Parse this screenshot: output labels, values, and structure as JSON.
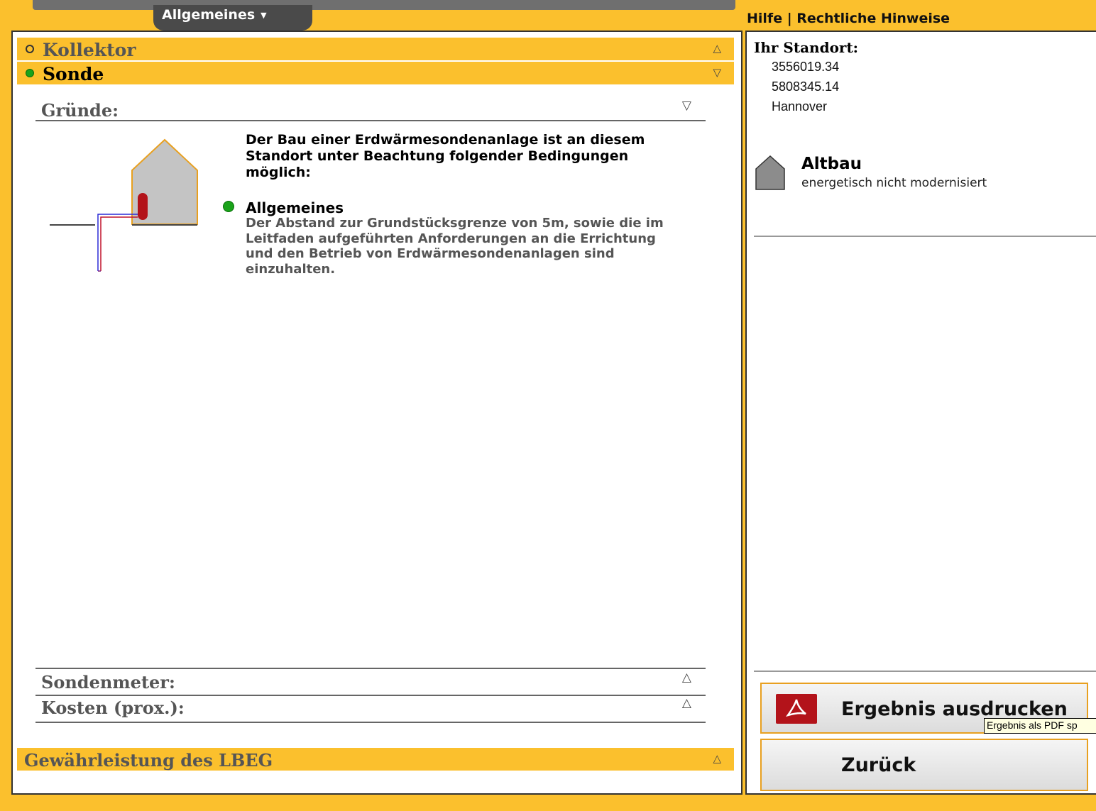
{
  "nav": {
    "tab_label": "Allgemeines",
    "help_links": "Hilfe | Rechtliche Hinweise"
  },
  "accordion": {
    "kollektor": "Kollektor",
    "sonde": "Sonde",
    "gewaehrleistung": "Gewährleistung des LBEG"
  },
  "sections": {
    "gruende": "Gründe:",
    "sondenmeter": "Sondenmeter:",
    "kosten": "Kosten (prox.):"
  },
  "reasons": {
    "intro": "Der Bau einer Erdwärmesondenanlage ist an diesem Standort unter Beachtung folgender Bedingungen möglich:",
    "condition_title": "Allgemeines",
    "condition_text": "Der Abstand zur Grundstücksgrenze von 5m, sowie die im Leitfaden aufgeführten Anforderungen an die Errichtung und den Betrieb von Erdwärmesondenanlagen sind einzuhalten."
  },
  "location": {
    "title": "Ihr Standort:",
    "x": "3556019.34",
    "y": "5808345.14",
    "city": "Hannover"
  },
  "building": {
    "title": "Altbau",
    "subtitle": "energetisch nicht modernisiert"
  },
  "buttons": {
    "print": "Ergebnis ausdrucken",
    "print_tooltip": "Ergebnis als PDF sp",
    "back": "Zurück"
  },
  "colors": {
    "accent": "#fbc02d",
    "ok": "#1aa31a",
    "pdf": "#b3131a"
  },
  "icons": {
    "collapse": "triangle-up-icon",
    "expand": "triangle-down-icon",
    "house": "house-icon",
    "pdf": "pdf-icon"
  }
}
